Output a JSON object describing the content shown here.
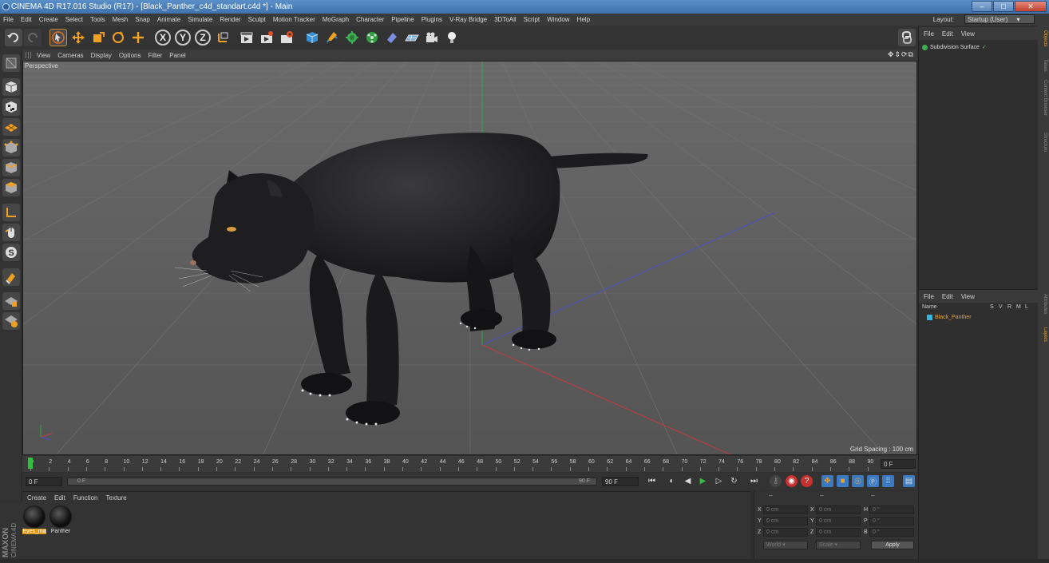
{
  "window": {
    "title": "CINEMA 4D R17.016 Studio (R17) - [Black_Panther_c4d_standart.c4d *] - Main"
  },
  "menubar": {
    "items": [
      "File",
      "Edit",
      "Create",
      "Select",
      "Tools",
      "Mesh",
      "Snap",
      "Animate",
      "Simulate",
      "Render",
      "Sculpt",
      "Motion Tracker",
      "MoGraph",
      "Character",
      "Pipeline",
      "Plugins",
      "V-Ray Bridge",
      "3DToAll",
      "Script",
      "Window",
      "Help"
    ],
    "layout_label": "Layout:",
    "layout_value": "Startup (User)"
  },
  "toolbar": {
    "axis_x": "X",
    "axis_y": "Y",
    "axis_z": "Z"
  },
  "viewport": {
    "menu": [
      "View",
      "Cameras",
      "Display",
      "Options",
      "Filter",
      "Panel"
    ],
    "camera_label": "Perspective",
    "grid_spacing": "Grid Spacing : 100 cm",
    "nav_icons": "✥⇕⟳⧉"
  },
  "timeline": {
    "ticks": [
      "0",
      "2",
      "4",
      "6",
      "8",
      "10",
      "12",
      "14",
      "16",
      "18",
      "20",
      "22",
      "24",
      "26",
      "28",
      "30",
      "32",
      "34",
      "36",
      "38",
      "40",
      "42",
      "44",
      "46",
      "48",
      "50",
      "52",
      "54",
      "56",
      "58",
      "60",
      "62",
      "64",
      "66",
      "68",
      "70",
      "72",
      "74",
      "76",
      "78",
      "80",
      "82",
      "84",
      "86",
      "88",
      "90"
    ],
    "current_frame": "0 F"
  },
  "transport": {
    "start_field": "0 F",
    "slider_start": "0 F",
    "slider_end": "90 F",
    "end_field": "90 F"
  },
  "material_panel": {
    "menu": [
      "Create",
      "Edit",
      "Function",
      "Texture"
    ],
    "materials": [
      {
        "label": "Eyes_ma",
        "active": true
      },
      {
        "label": "Panther",
        "active": false
      }
    ]
  },
  "coord_panel": {
    "headers": [
      "--",
      "--",
      "--"
    ],
    "rows": [
      {
        "a": "X",
        "av": "0 cm",
        "b": "X",
        "bv": "0 cm",
        "c": "H",
        "cv": "0 °"
      },
      {
        "a": "Y",
        "av": "0 cm",
        "b": "Y",
        "bv": "0 cm",
        "c": "P",
        "cv": "0 °"
      },
      {
        "a": "Z",
        "av": "0 cm",
        "b": "Z",
        "bv": "0 cm",
        "c": "B",
        "cv": "0 °"
      }
    ],
    "mode": "World",
    "transform": "Scale",
    "apply": "Apply"
  },
  "object_manager": {
    "menu": [
      "File",
      "Edit",
      "View"
    ],
    "objects": [
      "Subdivision Surface"
    ]
  },
  "layer_manager": {
    "menu": [
      "File",
      "Edit",
      "View"
    ],
    "columns": [
      "Name",
      "S",
      "V",
      "R",
      "M",
      "L"
    ],
    "layers": [
      "Black_Panther"
    ]
  },
  "right_tabs": [
    "Objects",
    "Takes",
    "Content Browser",
    "Structure"
  ],
  "right_tabs_lower": [
    "Attributes",
    "Layers"
  ],
  "brand": {
    "maxon": "MAXON",
    "product": "CINEMA 4D"
  }
}
